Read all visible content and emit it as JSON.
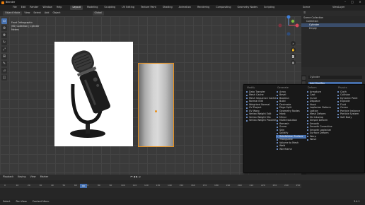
{
  "window": {
    "title": "Blender"
  },
  "menu": {
    "items": [
      "File",
      "Edit",
      "Render",
      "Window",
      "Help"
    ]
  },
  "workspaces": {
    "tabs": [
      "Layout",
      "Modeling",
      "Sculpting",
      "UV Editing",
      "Texture Paint",
      "Shading",
      "Animation",
      "Rendering",
      "Compositing",
      "Geometry Nodes",
      "Scripting"
    ],
    "active": "Layout"
  },
  "scene": {
    "label": "Scene",
    "layer": "ViewLayer"
  },
  "viewport_header": {
    "mode": "Object Mode",
    "items": [
      "View",
      "Select",
      "Add",
      "Object"
    ],
    "orientation": "Global"
  },
  "overlay": {
    "line1": "Front Orthographic",
    "line2": "(60) Collection | Cylinder",
    "line3": "Meters"
  },
  "outliner": {
    "title": "Scene Collection",
    "rows": [
      {
        "label": "Scene Collection",
        "selected": false
      },
      {
        "label": "Collection",
        "selected": false
      },
      {
        "label": "Cylinder",
        "selected": true
      },
      {
        "label": "Empty",
        "selected": false
      }
    ]
  },
  "properties": {
    "object": "Cylinder",
    "add_modifier": "Add Modifier"
  },
  "modifier_menu": {
    "columns": [
      {
        "title": "Modify",
        "items": [
          "Data Transfer",
          "Mesh Cache",
          "Mesh Sequence Cache",
          "Normal Edit",
          "Weighted Normal",
          "UV Project",
          "UV Warp",
          "Vertex Weight Edit",
          "Vertex Weight Mix",
          "Vertex Weight Proximity"
        ],
        "highlight": -1
      },
      {
        "title": "Generate",
        "items": [
          "Array",
          "Bevel",
          "Boolean",
          "Build",
          "Decimate",
          "Edge Split",
          "Geometry Nodes",
          "Mask",
          "Mirror",
          "Multiresolution",
          "Remesh",
          "Screw",
          "Skin",
          "Solidify",
          "Subdivision Surface",
          "Triangulate",
          "Volume to Mesh",
          "Weld",
          "Wireframe"
        ],
        "highlight": 14
      },
      {
        "title": "Deform",
        "items": [
          "Armature",
          "Cast",
          "Curve",
          "Displace",
          "Hook",
          "Laplacian Deform",
          "Lattice",
          "Mesh Deform",
          "Shrinkwrap",
          "Simple Deform",
          "Smooth",
          "Smooth Corrective",
          "Smooth Laplacian",
          "Surface Deform",
          "Warp",
          "Wave"
        ],
        "highlight": -1
      },
      {
        "title": "Physics",
        "items": [
          "Cloth",
          "Collision",
          "Dynamic Paint",
          "Explode",
          "Fluid",
          "Ocean",
          "Particle Instance",
          "Particle System",
          "Soft Body"
        ],
        "highlight": -1
      }
    ]
  },
  "timeline": {
    "items": [
      "Playback",
      "Keying",
      "View",
      "Marker"
    ],
    "current_frame": "60",
    "ticks": [
      "0",
      "10",
      "20",
      "30",
      "40",
      "50",
      "60",
      "70",
      "80",
      "90",
      "100",
      "110",
      "120",
      "130",
      "140",
      "150",
      "160",
      "170",
      "180",
      "190",
      "200",
      "210",
      "220",
      "230",
      "240",
      "250"
    ]
  },
  "status": {
    "items": [
      "Select",
      "Pan View",
      "Context Menu"
    ],
    "version": "3.4.1"
  }
}
